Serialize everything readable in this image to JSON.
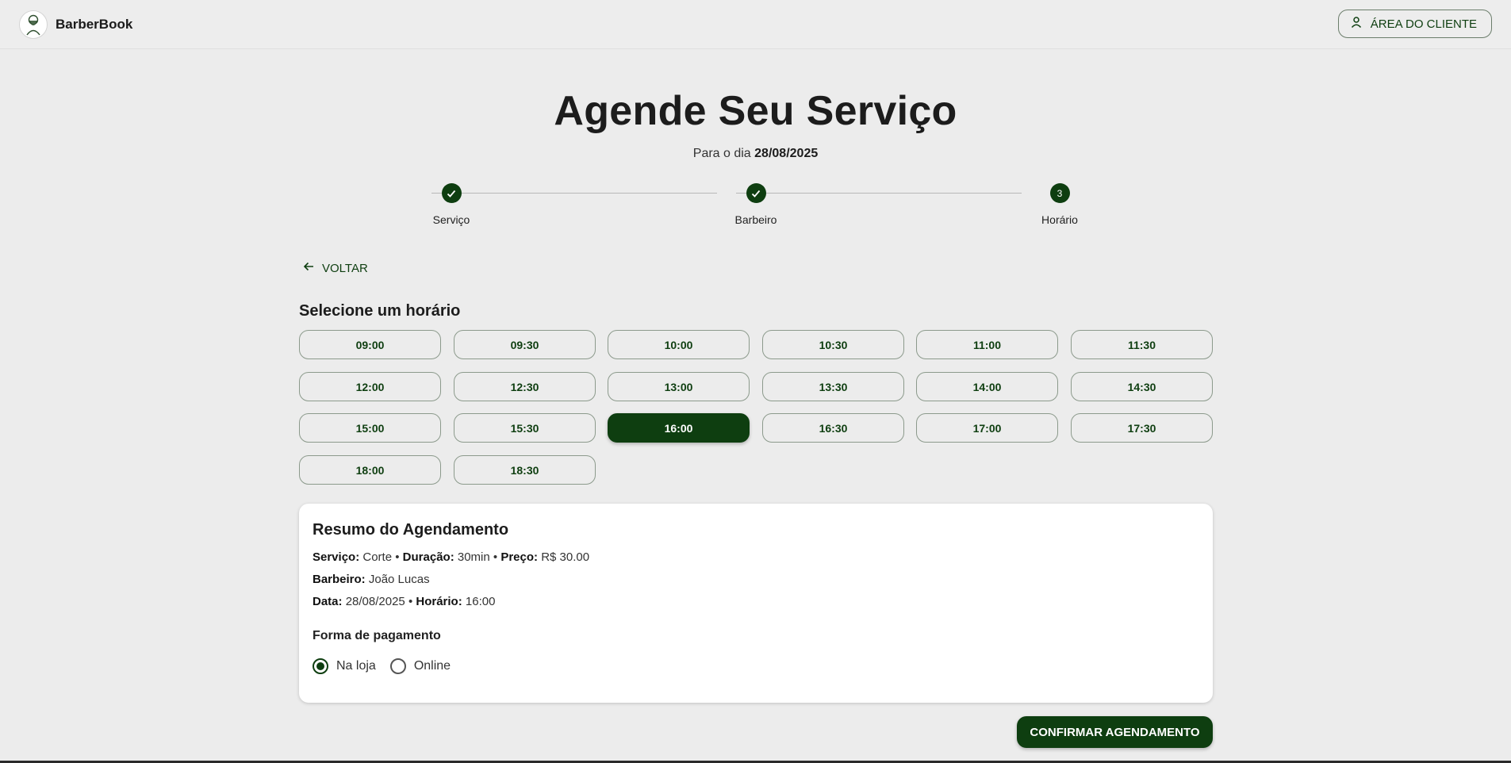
{
  "header": {
    "brand_name": "BarberBook",
    "client_area_label": "ÁREA DO CLIENTE"
  },
  "page": {
    "title": "Agende Seu Serviço",
    "subtitle_prefix": "Para o dia",
    "subtitle_date": "28/08/2025"
  },
  "stepper": {
    "steps": [
      {
        "label": "Serviço",
        "status": "done"
      },
      {
        "label": "Barbeiro",
        "status": "done"
      },
      {
        "label": "Horário",
        "status": "current",
        "number": "3"
      }
    ]
  },
  "back_label": "VOLTAR",
  "slots_title": "Selecione um horário",
  "slots": [
    "09:00",
    "09:30",
    "10:00",
    "10:30",
    "11:00",
    "11:30",
    "12:00",
    "12:30",
    "13:00",
    "13:30",
    "14:00",
    "14:30",
    "15:00",
    "15:30",
    "16:00",
    "16:30",
    "17:00",
    "17:30",
    "18:00",
    "18:30"
  ],
  "selected_slot": "16:00",
  "summary": {
    "title": "Resumo do Agendamento",
    "service_label": "Serviço:",
    "service_value": "Corte",
    "duration_label": "Duração:",
    "duration_value": "30min",
    "price_label": "Preço:",
    "price_value": "R$ 30.00",
    "barber_label": "Barbeiro:",
    "barber_value": "João Lucas",
    "date_label": "Data:",
    "date_value": "28/08/2025",
    "time_label": "Horário:",
    "time_value": "16:00",
    "separator": "•"
  },
  "payment": {
    "title": "Forma de pagamento",
    "options": [
      {
        "label": "Na loja",
        "selected": true
      },
      {
        "label": "Online",
        "selected": false
      }
    ]
  },
  "confirm_label": "CONFIRMAR AGENDAMENTO",
  "colors": {
    "accent": "#0e3e10",
    "background": "#ececec",
    "card": "#ffffff"
  }
}
